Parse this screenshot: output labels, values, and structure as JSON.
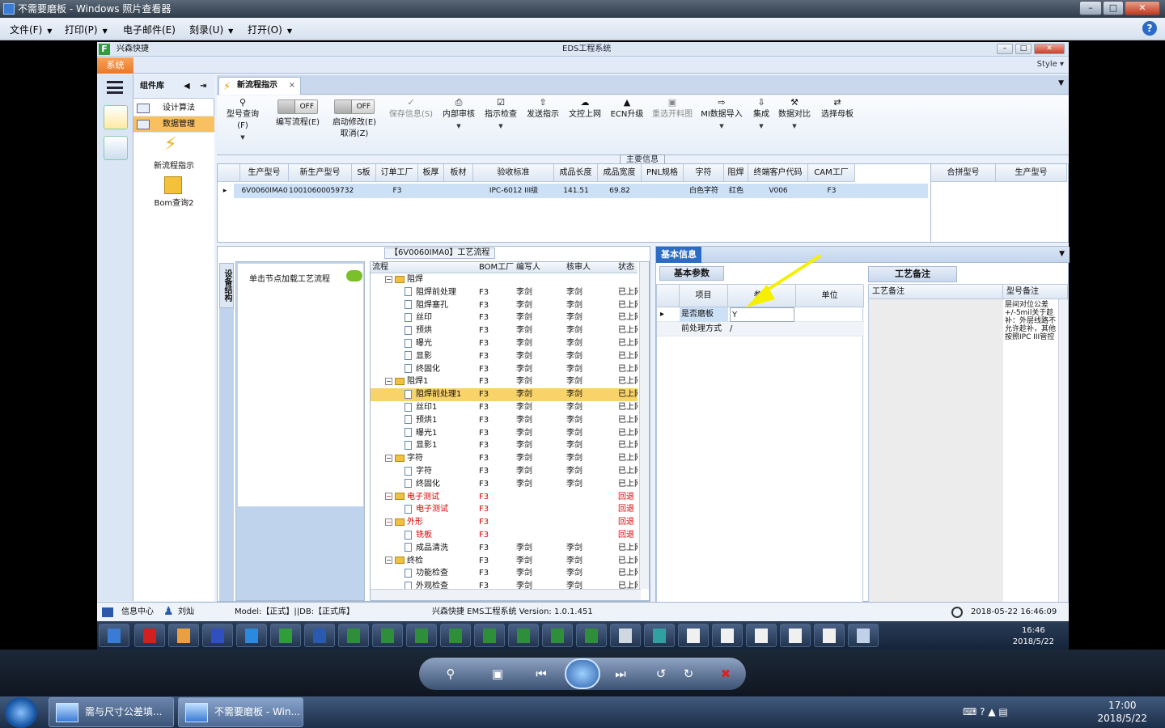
{
  "viewer": {
    "title": "不需要磨板 - Windows 照片查看器",
    "menu": [
      {
        "label": "文件(F)"
      },
      {
        "label": "打印(P)"
      },
      {
        "label": "电子邮件(E)"
      },
      {
        "label": "刻录(U)"
      },
      {
        "label": "打开(O)"
      }
    ],
    "help": "?"
  },
  "app": {
    "title_left": "兴森快捷",
    "title_center": "EDS工程系统",
    "system_tab": "系统",
    "style": "Style",
    "component_lib": "组件库",
    "nav_items": [
      {
        "label": "设计算法"
      },
      {
        "label": "数据管理"
      }
    ],
    "big_items": [
      {
        "label": "新流程指示"
      },
      {
        "label": "Bom查询2"
      }
    ],
    "doc_tab": "新流程指示",
    "ribbon": {
      "model_query": "型号查询(F)",
      "toggle_off": "OFF",
      "edit_flow": "编写流程(E)",
      "enable_edit": "启动修改(E)",
      "cancel": "取消(Z)",
      "save": "保存信息(S)",
      "internal_review": "内部审核",
      "check": "指示检查",
      "send": "发送指示",
      "upload": "文控上网",
      "ecn": "ECN升级",
      "redraw": "重选开料图",
      "mi_import": "MI数据导入",
      "collect": "集成",
      "compare": "数据对比",
      "choose": "选择母板"
    },
    "group_main": "主要信息",
    "main_cols": [
      "生产型号",
      "新生产型号",
      "S板",
      "订单工厂",
      "板厚",
      "板材",
      "验收标准",
      "成品长度",
      "成品宽度",
      "PNL规格",
      "字符",
      "阻焊",
      "终端客户代码",
      "CAM工厂"
    ],
    "main_row": [
      "6V0060IMA0",
      "10010600059732",
      "",
      "F3",
      "",
      "",
      "IPC-6012 III级",
      "141.51",
      "69.82",
      "",
      "白色字符",
      "红色",
      "V006",
      "F3"
    ],
    "merge_cols": [
      "合拼型号",
      "生产型号"
    ],
    "flow_panel_title": "【6V0060IMA0】工艺流程",
    "device_tab": "设备结构",
    "node_hint": "单击节点加载工艺流程",
    "tree_cols": [
      "流程",
      "BOM工厂",
      "编写人",
      "核审人",
      "状态"
    ],
    "tree": [
      {
        "name": "阻焊",
        "type": "folder",
        "f": "",
        "a": "",
        "b": "",
        "s": ""
      },
      {
        "name": "阻焊前处理",
        "type": "doc",
        "f": "F3",
        "a": "李剑",
        "b": "李剑",
        "s": "已上网"
      },
      {
        "name": "阻焊塞孔",
        "type": "doc",
        "f": "F3",
        "a": "李剑",
        "b": "李剑",
        "s": "已上网"
      },
      {
        "name": "丝印",
        "type": "doc",
        "f": "F3",
        "a": "李剑",
        "b": "李剑",
        "s": "已上网"
      },
      {
        "name": "预烘",
        "type": "doc",
        "f": "F3",
        "a": "李剑",
        "b": "李剑",
        "s": "已上网"
      },
      {
        "name": "曝光",
        "type": "doc",
        "f": "F3",
        "a": "李剑",
        "b": "李剑",
        "s": "已上网"
      },
      {
        "name": "显影",
        "type": "doc",
        "f": "F3",
        "a": "李剑",
        "b": "李剑",
        "s": "已上网"
      },
      {
        "name": "终固化",
        "type": "doc",
        "f": "F3",
        "a": "李剑",
        "b": "李剑",
        "s": "已上网"
      },
      {
        "name": "阻焊1",
        "type": "folder",
        "f": "F3",
        "a": "李剑",
        "b": "李剑",
        "s": "已上网"
      },
      {
        "name": "阻焊前处理1",
        "type": "doc",
        "f": "F3",
        "a": "李剑",
        "b": "李剑",
        "s": "已上网",
        "hl": true
      },
      {
        "name": "丝印1",
        "type": "doc",
        "f": "F3",
        "a": "李剑",
        "b": "李剑",
        "s": "已上网"
      },
      {
        "name": "预烘1",
        "type": "doc",
        "f": "F3",
        "a": "李剑",
        "b": "李剑",
        "s": "已上网"
      },
      {
        "name": "曝光1",
        "type": "doc",
        "f": "F3",
        "a": "李剑",
        "b": "李剑",
        "s": "已上网"
      },
      {
        "name": "显影1",
        "type": "doc",
        "f": "F3",
        "a": "李剑",
        "b": "李剑",
        "s": "已上网"
      },
      {
        "name": "字符",
        "type": "folder",
        "f": "F3",
        "a": "李剑",
        "b": "李剑",
        "s": "已上网"
      },
      {
        "name": "字符",
        "type": "doc",
        "f": "F3",
        "a": "李剑",
        "b": "李剑",
        "s": "已上网"
      },
      {
        "name": "终固化",
        "type": "doc",
        "f": "F3",
        "a": "李剑",
        "b": "李剑",
        "s": "已上网"
      },
      {
        "name": "电子测试",
        "type": "folder",
        "f": "F3",
        "a": "",
        "b": "",
        "s": "回退",
        "red": true
      },
      {
        "name": "电子测试",
        "type": "doc",
        "f": "F3",
        "a": "",
        "b": "",
        "s": "回退",
        "red": true
      },
      {
        "name": "外形",
        "type": "folder",
        "f": "F3",
        "a": "",
        "b": "",
        "s": "回退",
        "red": true
      },
      {
        "name": "铣板",
        "type": "doc",
        "f": "F3",
        "a": "",
        "b": "",
        "s": "回退",
        "red": true
      },
      {
        "name": "成品清洗",
        "type": "doc",
        "f": "F3",
        "a": "李剑",
        "b": "李剑",
        "s": "已上网"
      },
      {
        "name": "终检",
        "type": "folder",
        "f": "F3",
        "a": "李剑",
        "b": "李剑",
        "s": "已上网"
      },
      {
        "name": "功能检查",
        "type": "doc",
        "f": "F3",
        "a": "李剑",
        "b": "李剑",
        "s": "已上网"
      },
      {
        "name": "外观检查",
        "type": "doc",
        "f": "F3",
        "a": "李剑",
        "b": "李剑",
        "s": "已上网"
      }
    ],
    "basic_info": "基本信息",
    "basic_params": "基本参数",
    "param_cols": [
      "项目",
      "参数",
      "单位"
    ],
    "params": [
      {
        "item": "是否磨板",
        "value": "Y",
        "unit": ""
      },
      {
        "item": "前处理方式",
        "value": "/",
        "unit": ""
      }
    ],
    "process_remark_tab": "工艺备注",
    "remark_cols": [
      "工艺备注",
      "型号备注"
    ],
    "model_remark": "层间对位公差+/-5mil关于趁补：外层线路不允许趁补，其他按照IPC III管控",
    "status": {
      "info_center": "信息中心",
      "user": "刘灿",
      "model": "Model:【正式】||DB:【正式库】",
      "version": "兴森快捷 EMS工程系统 Version: 1.0.1.451",
      "datetime": "2018-05-22 16:46:09"
    },
    "task_clock": {
      "time": "16:46",
      "date": "2018/5/22"
    }
  },
  "taskbar": {
    "items": [
      {
        "label": "需与尺寸公差填..."
      },
      {
        "label": "不需要磨板 - Win..."
      }
    ],
    "time": "17:00",
    "date": "2018/5/22"
  },
  "colors": {
    "accent": "#2c6cc4",
    "system_tab": "#e8782a",
    "highlight": "#f8d36a",
    "arrow": "#f5f000"
  }
}
